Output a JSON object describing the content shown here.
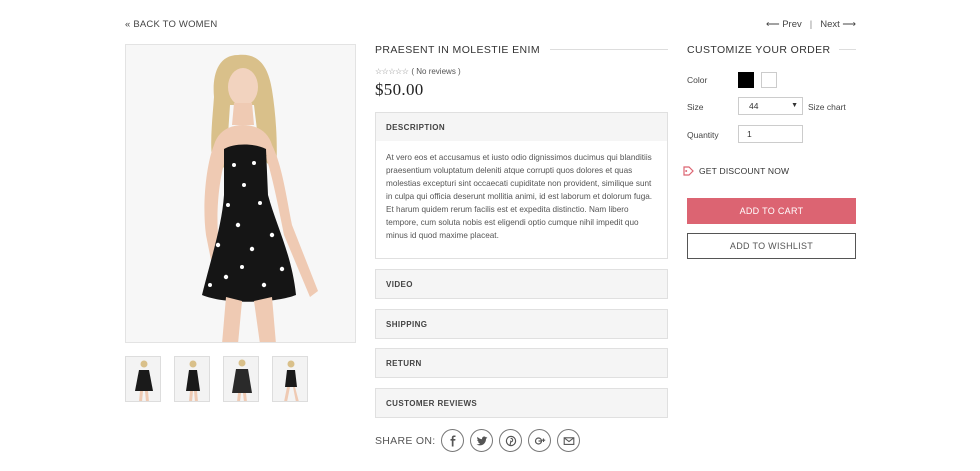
{
  "nav": {
    "back_label": "« BACK TO WOMEN",
    "prev_label": "⟵ Prev",
    "separator": "|",
    "next_label": "Next ⟶"
  },
  "gallery": {
    "main_image": "model-black-star-romper",
    "thumbnails": [
      "front-view",
      "side-view",
      "back-view",
      "walking-view"
    ]
  },
  "product": {
    "title": "PRAESENT IN MOLESTIE ENIM",
    "rating_stars": "☆☆☆☆☆",
    "rating_text": "( No reviews )",
    "price": "$50.00"
  },
  "accordion": {
    "description": {
      "label": "DESCRIPTION",
      "body": "At vero eos et accusamus et iusto odio dignissimos ducimus qui blanditiis praesentium voluptatum deleniti atque corrupti quos dolores et quas molestias excepturi sint occaecati cupiditate non provident, similique sunt in culpa qui officia deserunt mollitia animi, id est laborum et dolorum fuga. Et harum quidem rerum facilis est et expedita distinctio. Nam libero tempore, cum soluta nobis est eligendi optio cumque nihil impedit quo minus id quod maxime placeat."
    },
    "video": "VIDEO",
    "shipping": "SHIPPING",
    "return": "RETURN",
    "reviews": "CUSTOMER REVIEWS"
  },
  "share": {
    "label": "SHARE ON:",
    "icons": [
      "facebook-icon",
      "twitter-icon",
      "pinterest-icon",
      "google-plus-icon",
      "email-icon"
    ]
  },
  "customize": {
    "title": "CUSTOMIZE YOUR ORDER",
    "color_label": "Color",
    "colors": [
      "#000000",
      "#ffffff"
    ],
    "size_label": "Size",
    "size_value": "44",
    "size_chart": "Size chart",
    "quantity_label": "Quantity",
    "quantity_value": "1",
    "discount": "GET DISCOUNT NOW",
    "add_to_cart": "ADD TO CART",
    "add_to_wishlist": "ADD TO WISHLIST"
  },
  "colors": {
    "accent": "#dc6472"
  }
}
